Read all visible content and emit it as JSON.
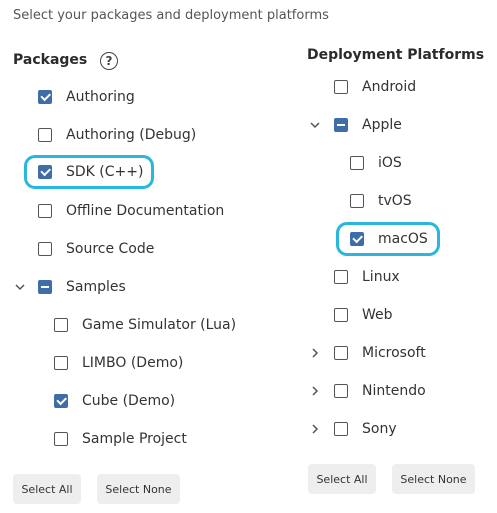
{
  "hint": "Select your packages and deployment platforms",
  "packages": {
    "header": "Packages",
    "help_icon": "?",
    "items": [
      {
        "label": "Authoring",
        "state": "checked"
      },
      {
        "label": "Authoring (Debug)",
        "state": "unchecked"
      },
      {
        "label": "SDK (C++)",
        "state": "checked",
        "highlighted": true
      },
      {
        "label": "Offline Documentation",
        "state": "unchecked"
      },
      {
        "label": "Source Code",
        "state": "unchecked"
      },
      {
        "label": "Samples",
        "state": "indeterminate",
        "expander": "expanded"
      },
      {
        "label": "Game Simulator (Lua)",
        "state": "unchecked"
      },
      {
        "label": "LIMBO (Demo)",
        "state": "unchecked"
      },
      {
        "label": "Cube (Demo)",
        "state": "checked"
      },
      {
        "label": "Sample Project",
        "state": "unchecked"
      }
    ],
    "select_all": "Select All",
    "select_none": "Select None"
  },
  "platforms": {
    "header": "Deployment Platforms",
    "items": [
      {
        "label": "Android",
        "state": "unchecked"
      },
      {
        "label": "Apple",
        "state": "indeterminate",
        "expander": "expanded"
      },
      {
        "label": "iOS",
        "state": "unchecked"
      },
      {
        "label": "tvOS",
        "state": "unchecked"
      },
      {
        "label": "macOS",
        "state": "checked",
        "highlighted": true
      },
      {
        "label": "Linux",
        "state": "unchecked"
      },
      {
        "label": "Web",
        "state": "unchecked"
      },
      {
        "label": "Microsoft",
        "state": "unchecked",
        "expander": "collapsed"
      },
      {
        "label": "Nintendo",
        "state": "unchecked",
        "expander": "collapsed"
      },
      {
        "label": "Sony",
        "state": "unchecked",
        "expander": "collapsed"
      }
    ],
    "select_all": "Select All",
    "select_none": "Select None"
  },
  "colors": {
    "accent": "#3f6da8",
    "highlight": "#29b6df",
    "button_bg": "#eeeeee"
  }
}
